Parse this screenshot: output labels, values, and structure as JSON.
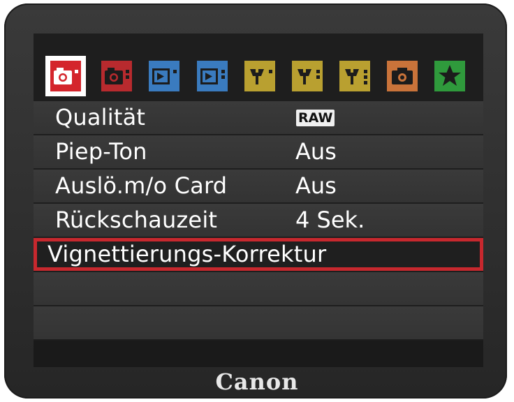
{
  "tabs": [
    {
      "name": "shooting-1",
      "icon": "camera-icon",
      "color": "#d4252c",
      "dots": 1,
      "active": true
    },
    {
      "name": "shooting-2",
      "icon": "camera-icon",
      "color": "#b82a2e",
      "dots": 2,
      "active": false
    },
    {
      "name": "playback-1",
      "icon": "playback-icon",
      "color": "#3a7bbf",
      "dots": 1,
      "active": false
    },
    {
      "name": "playback-2",
      "icon": "playback-icon",
      "color": "#3a7bbf",
      "dots": 2,
      "active": false
    },
    {
      "name": "setup-1",
      "icon": "wrench-icon",
      "color": "#b9a030",
      "dots": 1,
      "active": false
    },
    {
      "name": "setup-2",
      "icon": "wrench-icon",
      "color": "#b9a030",
      "dots": 2,
      "active": false
    },
    {
      "name": "setup-3",
      "icon": "wrench-icon",
      "color": "#b9a030",
      "dots": 3,
      "active": false
    },
    {
      "name": "custom-functions",
      "icon": "custom-camera-icon",
      "color": "#c9733a",
      "dots": 0,
      "active": false
    },
    {
      "name": "my-menu",
      "icon": "star-icon",
      "color": "#2f9a3c",
      "dots": 0,
      "active": false
    }
  ],
  "menu": {
    "items": [
      {
        "label": "Qualität",
        "value": "RAW",
        "value_type": "badge"
      },
      {
        "label": "Piep-Ton",
        "value": "Aus",
        "value_type": "text"
      },
      {
        "label": "Auslö.m/o Card",
        "value": "Aus",
        "value_type": "text"
      },
      {
        "label": "Rückschauzeit",
        "value": "4 Sek.",
        "value_type": "text"
      },
      {
        "label": "Vignettierungs-Korrektur",
        "value": "",
        "value_type": "none",
        "selected": true
      }
    ]
  },
  "accent_color": "#c7282e",
  "brand": "Canon"
}
